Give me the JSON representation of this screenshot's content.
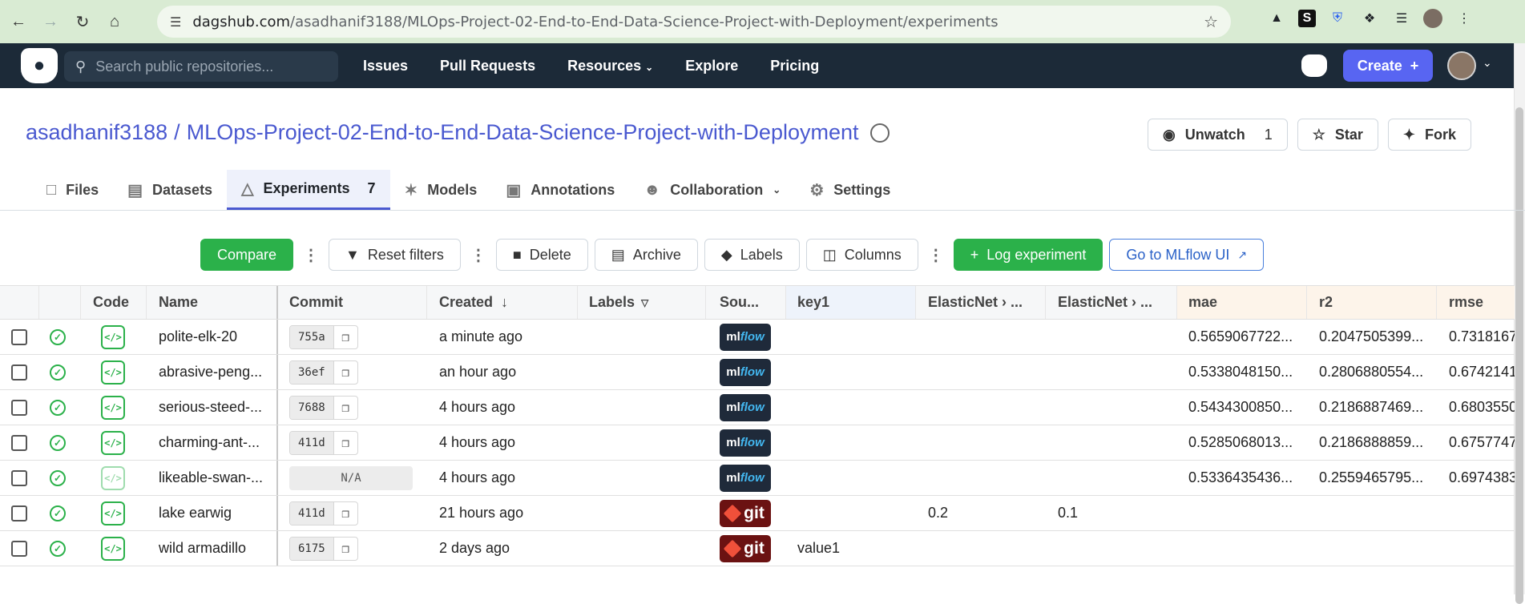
{
  "browser": {
    "url_host": "dagshub.com",
    "url_path": "/asadhanif3188/MLOps-Project-02-End-to-End-Data-Science-Project-with-Deployment/experiments"
  },
  "topnav": {
    "search_placeholder": "Search public repositories...",
    "links": [
      "Issues",
      "Pull Requests",
      "Resources",
      "Explore",
      "Pricing"
    ],
    "create_label": "Create"
  },
  "repo": {
    "owner": "asadhanif3188",
    "separator": "/",
    "name": "MLOps-Project-02-End-to-End-Data-Science-Project-with-Deployment",
    "unwatch_label": "Unwatch",
    "unwatch_count": "1",
    "star_label": "Star",
    "fork_label": "Fork"
  },
  "tabs": [
    {
      "label": "Files",
      "icon": "file-icon"
    },
    {
      "label": "Datasets",
      "icon": "datasets-icon"
    },
    {
      "label": "Experiments",
      "icon": "flask-icon",
      "count": "7"
    },
    {
      "label": "Models",
      "icon": "models-icon"
    },
    {
      "label": "Annotations",
      "icon": "annotations-icon"
    },
    {
      "label": "Collaboration",
      "icon": "collaboration-icon"
    },
    {
      "label": "Settings",
      "icon": "gear-icon"
    }
  ],
  "toolbar": {
    "compare": "Compare",
    "reset_filters": "Reset filters",
    "delete": "Delete",
    "archive": "Archive",
    "labels": "Labels",
    "columns": "Columns",
    "log_experiment": "Log experiment",
    "mlflow_ui": "Go to MLflow UI"
  },
  "table": {
    "headers": {
      "code": "Code",
      "name": "Name",
      "commit": "Commit",
      "created": "Created",
      "labels": "Labels",
      "source": "Sou...",
      "key1": "key1",
      "en1": "ElasticNet › ...",
      "en2": "ElasticNet › ...",
      "mae": "mae",
      "r2": "r2",
      "rmse": "rmse"
    },
    "rows": [
      {
        "name": "polite-elk-20",
        "commit": "755a",
        "created": "a minute ago",
        "source": "mlflow",
        "key1": "",
        "en1": "",
        "en2": "",
        "mae": "0.5659067722...",
        "r2": "0.2047505399...",
        "rmse": "0.7318167"
      },
      {
        "name": "abrasive-peng...",
        "commit": "36ef",
        "created": "an hour ago",
        "source": "mlflow",
        "key1": "",
        "en1": "",
        "en2": "",
        "mae": "0.5338048150...",
        "r2": "0.2806880554...",
        "rmse": "0.6742141"
      },
      {
        "name": "serious-steed-...",
        "commit": "7688",
        "created": "4 hours ago",
        "source": "mlflow",
        "key1": "",
        "en1": "",
        "en2": "",
        "mae": "0.5434300850...",
        "r2": "0.2186887469...",
        "rmse": "0.6803550"
      },
      {
        "name": "charming-ant-...",
        "commit": "411d",
        "created": "4 hours ago",
        "source": "mlflow",
        "key1": "",
        "en1": "",
        "en2": "",
        "mae": "0.5285068013...",
        "r2": "0.2186888859...",
        "rmse": "0.6757747"
      },
      {
        "name": "likeable-swan-...",
        "commit": "N/A",
        "created": "4 hours ago",
        "source": "mlflow",
        "key1": "",
        "en1": "",
        "en2": "",
        "mae": "0.5336435436...",
        "r2": "0.2559465795...",
        "rmse": "0.6974383"
      },
      {
        "name": "lake earwig",
        "commit": "411d",
        "created": "21 hours ago",
        "source": "git",
        "key1": "",
        "en1": "0.2",
        "en2": "0.1",
        "mae": "",
        "r2": "",
        "rmse": ""
      },
      {
        "name": "wild armadillo",
        "commit": "6175",
        "created": "2 days ago",
        "source": "git",
        "key1": "value1",
        "en1": "",
        "en2": "",
        "mae": "",
        "r2": "",
        "rmse": ""
      }
    ]
  },
  "colors": {
    "accent": "#4a59d0",
    "green": "#2bb14a",
    "nav_bg": "#1c2a38",
    "browser_bar": "#d9ebd3"
  }
}
